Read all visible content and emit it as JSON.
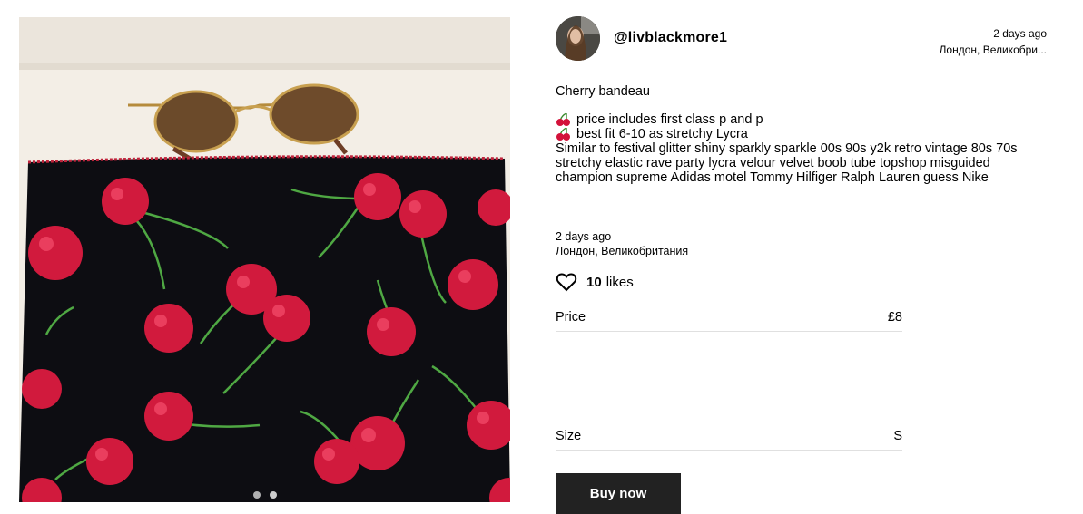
{
  "seller": {
    "username": "@livblackmore1",
    "time": "2 days ago",
    "location": "Лондон, Великобри..."
  },
  "listing": {
    "title": "Cherry bandeau",
    "bullets": [
      "price includes first class p and p",
      "best fit 6-10 as stretchy Lycra"
    ],
    "description": "Similar to festival glitter shiny sparkly sparkle 00s 90s y2k retro vintage 80s 70s stretchy elastic rave party lycra velour velvet boob tube topshop misguided champion supreme Adidas motel Tommy Hilfiger Ralph Lauren guess Nike",
    "posted_time": "2 days ago",
    "posted_location": "Лондон, Великобритания"
  },
  "likes": {
    "count": "10",
    "label": "likes"
  },
  "attributes": {
    "price_label": "Price",
    "price_value": "£8",
    "size_label": "Size",
    "size_value": "S"
  },
  "actions": {
    "buy_label": "Buy now"
  },
  "gallery": {
    "image_count": 2,
    "active_index": 1
  },
  "icons": {
    "heart": "heart-outline-icon",
    "bullet": "cherry-emoji-icon"
  },
  "colors": {
    "button_bg": "#222222",
    "divider": "#e0e0e0"
  }
}
